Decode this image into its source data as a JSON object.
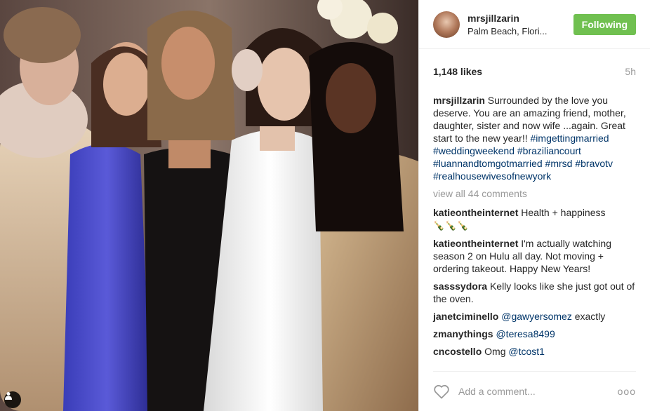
{
  "post": {
    "username": "mrsjillzarin",
    "location": "Palm Beach, Flori...",
    "follow_label": "Following",
    "likes": "1,148 likes",
    "time": "5h",
    "caption_user": "mrsjillzarin",
    "caption_text": " Surrounded by the love you deserve. You are an amazing friend, mother, daughter, sister and now wife ...again. Great start to the new year!! ",
    "hashtags": [
      "#imgettingmarried",
      "#weddingweekend",
      "#braziliancourt",
      "#luannandtomgotmarried",
      "#mrsd",
      "#bravotv",
      "#realhousewivesofnewyork"
    ],
    "view_all": "view all 44 comments",
    "comments": [
      {
        "user": "katieontheinternet",
        "text": " Health + happiness",
        "extra": "🍾🍾🍾"
      },
      {
        "user": "katieontheinternet",
        "text": " I'm actually watching season 2 on Hulu all day. Not moving + ordering takeout. Happy New Years!"
      },
      {
        "user": "sasssydora",
        "text": " Kelly looks like she just got out of the oven."
      },
      {
        "user": "janetciminello",
        "mention": "@gawyersomez",
        "text": " exactly"
      },
      {
        "user": "zmanythings",
        "mention": "@teresa8499",
        "text": ""
      },
      {
        "user": "cncostello",
        "text": " Omg ",
        "mention_after": "@tcost1"
      }
    ],
    "add_comment_placeholder": "Add a comment...",
    "more_label": "ooo"
  },
  "colors": {
    "follow": "#70c050",
    "hashtag": "#003569",
    "muted": "#999999"
  },
  "icons": {
    "tag": "person-tag-icon",
    "heart": "heart-outline-icon",
    "more": "more-options-icon"
  }
}
